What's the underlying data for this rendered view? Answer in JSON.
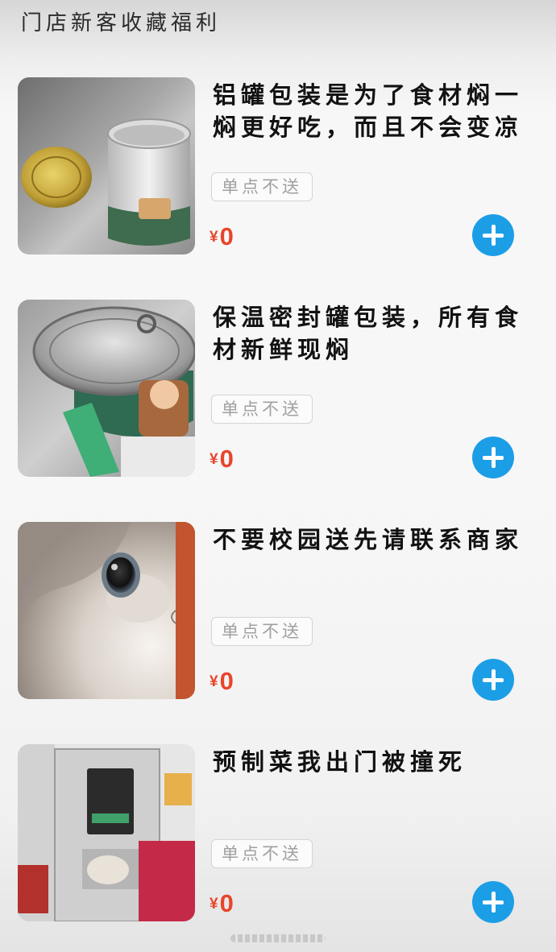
{
  "header": {
    "title": "门店新客收藏福利"
  },
  "items": [
    {
      "title": "铝罐包装是为了食材焖一焖更好吃，而且不会变凉",
      "tag": "单点不送",
      "currency": "¥",
      "price": "0",
      "image_icon": "aluminum-can-photo"
    },
    {
      "title": "保温密封罐包装，所有食材新鲜现焖",
      "tag": "单点不送",
      "currency": "¥",
      "price": "0",
      "image_icon": "sealed-can-photo"
    },
    {
      "title": "不要校园送先请联系商家",
      "tag": "单点不送",
      "currency": "¥",
      "price": "0",
      "image_icon": "cat-photo"
    },
    {
      "title": "预制菜我出门被撞死",
      "tag": "单点不送",
      "currency": "¥",
      "price": "0",
      "image_icon": "sealing-machine-photo"
    }
  ],
  "colors": {
    "accent": "#1c9ee7",
    "price": "#e8452a",
    "tag_text": "#a0a0a0"
  }
}
